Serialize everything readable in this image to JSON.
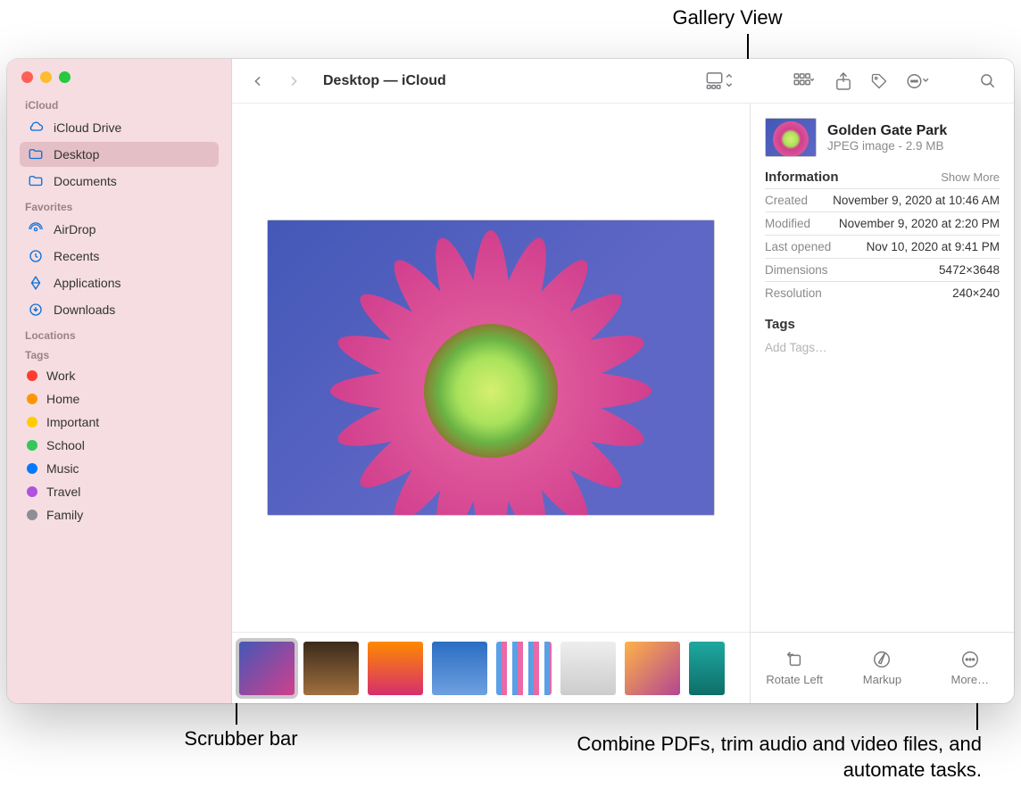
{
  "callouts": {
    "galleryView": "Gallery View",
    "scrubber": "Scrubber bar",
    "more": "Combine PDFs, trim audio and video files, and automate tasks."
  },
  "trafficColors": {
    "close": "#ff5f57",
    "min": "#febc2e",
    "max": "#28c840"
  },
  "sidebar": {
    "sections": {
      "icloud": "iCloud",
      "favorites": "Favorites",
      "locations": "Locations",
      "tags": "Tags"
    },
    "icloud": [
      {
        "label": "iCloud Drive",
        "icon": "cloud"
      },
      {
        "label": "Desktop",
        "icon": "folder",
        "active": true
      },
      {
        "label": "Documents",
        "icon": "folder"
      }
    ],
    "favorites": [
      {
        "label": "AirDrop",
        "icon": "airdrop"
      },
      {
        "label": "Recents",
        "icon": "clock"
      },
      {
        "label": "Applications",
        "icon": "apps"
      },
      {
        "label": "Downloads",
        "icon": "download"
      }
    ],
    "tags": [
      {
        "label": "Work",
        "color": "#ff3b30"
      },
      {
        "label": "Home",
        "color": "#ff9500"
      },
      {
        "label": "Important",
        "color": "#ffcc00"
      },
      {
        "label": "School",
        "color": "#34c759"
      },
      {
        "label": "Music",
        "color": "#007aff"
      },
      {
        "label": "Travel",
        "color": "#af52de"
      },
      {
        "label": "Family",
        "color": "#8e8e93"
      }
    ]
  },
  "toolbar": {
    "title": "Desktop — iCloud"
  },
  "info": {
    "title": "Golden Gate Park",
    "subtitle": "JPEG image - 2.9 MB",
    "sectionInfo": "Information",
    "showMore": "Show More",
    "rows": {
      "created": {
        "k": "Created",
        "v": "November 9, 2020 at 10:46 AM"
      },
      "modified": {
        "k": "Modified",
        "v": "November 9, 2020 at 2:20 PM"
      },
      "lastOpened": {
        "k": "Last opened",
        "v": "Nov 10, 2020 at 9:41 PM"
      },
      "dimensions": {
        "k": "Dimensions",
        "v": "5472×3648"
      },
      "resolution": {
        "k": "Resolution",
        "v": "240×240"
      }
    },
    "tagsLabel": "Tags",
    "tagsPlaceholder": "Add Tags…",
    "actions": {
      "rotate": "Rotate Left",
      "markup": "Markup",
      "more": "More…"
    }
  }
}
